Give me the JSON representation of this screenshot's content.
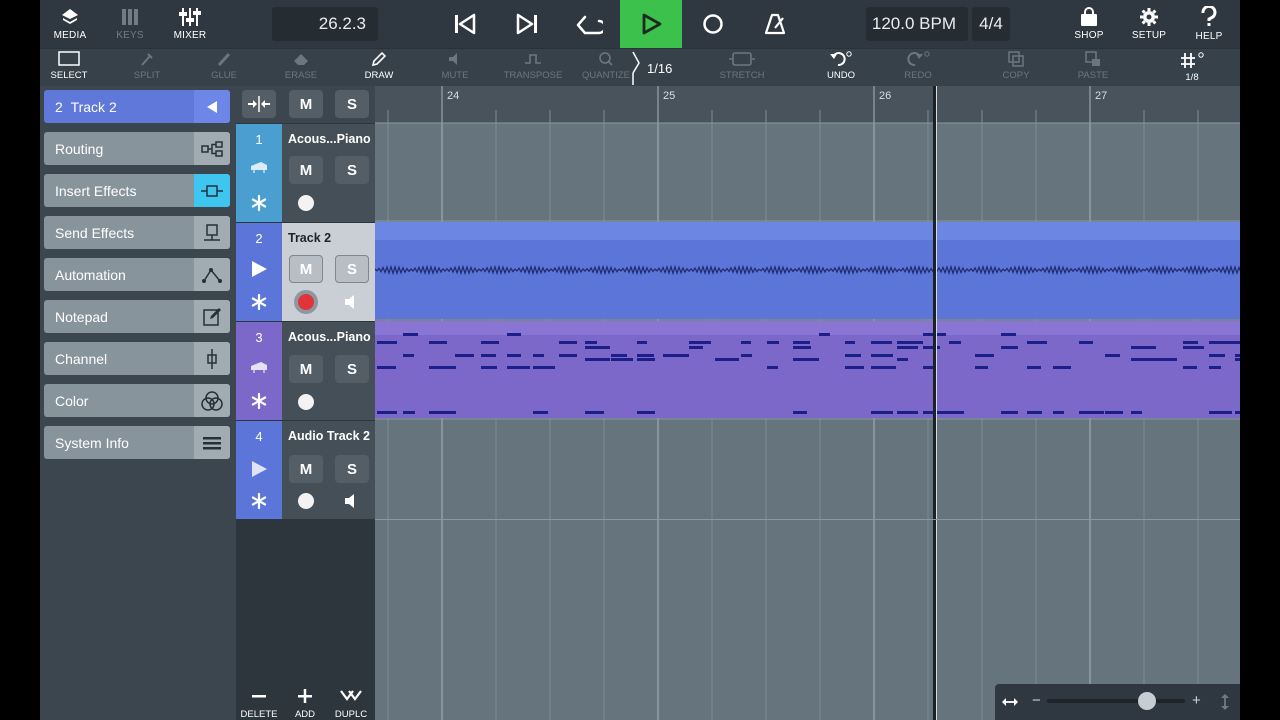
{
  "top": {
    "media_label": "MEDIA",
    "keys_label": "KEYS",
    "mixer_label": "MIXER",
    "position": "26.2.3",
    "tempo": "120.0 BPM",
    "signature": "4/4",
    "shop_label": "SHOP",
    "setup_label": "SETUP",
    "help_label": "HELP"
  },
  "tools": {
    "select": "SELECT",
    "split": "SPLIT",
    "glue": "GLUE",
    "erase": "ERASE",
    "draw": "DRAW",
    "mute": "MUTE",
    "transpose": "TRANSPOSE",
    "quantize": "QUANTIZE",
    "quantize_value": "1/16",
    "stretch": "STRETCH",
    "undo": "UNDO",
    "redo": "REDO",
    "copy": "COPY",
    "paste": "PASTE",
    "grid_value": "1/8"
  },
  "inspector": {
    "header_num": "2",
    "header_name": "Track 2",
    "items": [
      "Routing",
      "Insert Effects",
      "Send Effects",
      "Automation",
      "Notepad",
      "Channel",
      "Color",
      "System Info"
    ]
  },
  "tracklist": {
    "header_m": "M",
    "header_s": "S",
    "mute_label": "M",
    "solo_label": "S",
    "tracks": [
      {
        "num": "1",
        "name": "Acous...Piano"
      },
      {
        "num": "2",
        "name": "Track 2"
      },
      {
        "num": "3",
        "name": "Acous...Piano"
      },
      {
        "num": "4",
        "name": "Audio Track 2"
      }
    ],
    "delete_label": "DELETE",
    "add_label": "ADD",
    "duplicate_label": "DUPLC"
  },
  "ruler": {
    "bars": [
      "24",
      "25",
      "26",
      "27"
    ]
  },
  "colors": {
    "track1": "#4a9fd0",
    "track2": "#5b76d8",
    "track3": "#7b68c8",
    "track4": "#5b76d8",
    "play": "#3cc14d",
    "active_icon": "#3ec5f0",
    "record": "#e0333c"
  },
  "icons": [
    "media-icon",
    "keys-icon",
    "mixer-icon",
    "skip-back-icon",
    "skip-forward-icon",
    "loop-icon",
    "play-icon",
    "record-icon",
    "metronome-icon",
    "shop-icon",
    "setup-icon",
    "help-icon"
  ]
}
